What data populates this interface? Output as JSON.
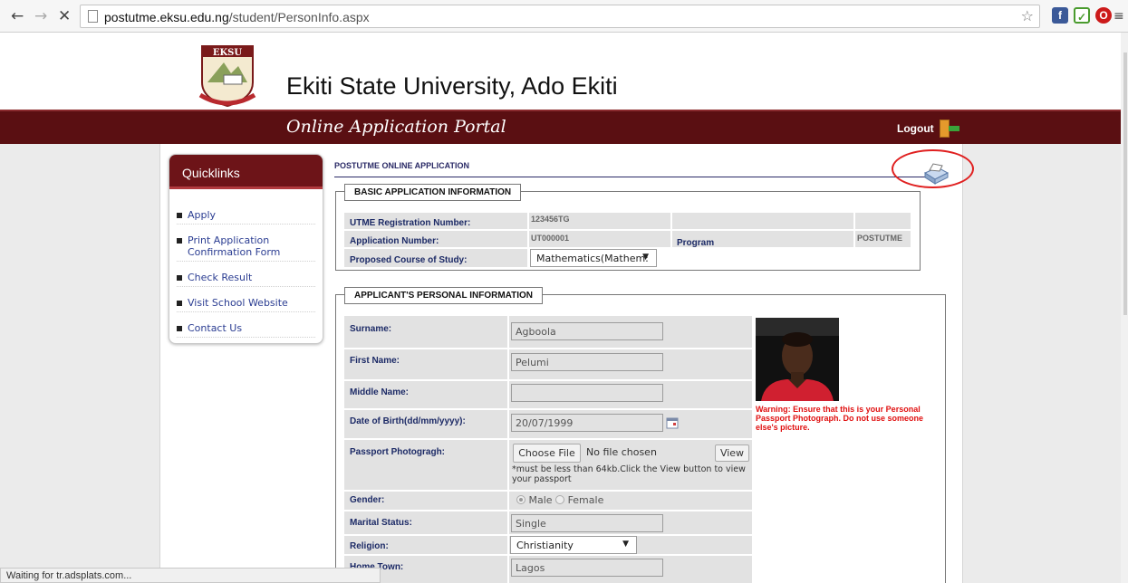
{
  "browser": {
    "url_host": "postutme.eksu.edu.ng",
    "url_path": "/student/PersonInfo.aspx",
    "status_text": "Waiting for tr.adsplats.com...",
    "extensions": [
      "facebook-icon",
      "shield-check-icon",
      "opera-icon"
    ]
  },
  "header": {
    "university_name": "Ekiti State University, Ado Ekiti",
    "logo_text": "EKSU",
    "portal_title": "Online Application Portal",
    "logout_label": "Logout"
  },
  "sidebar": {
    "title": "Quicklinks",
    "items": [
      {
        "label": "Apply"
      },
      {
        "label": "Print Application Confirmation Form"
      },
      {
        "label": "Check Result"
      },
      {
        "label": "Visit School Website"
      },
      {
        "label": "Contact Us"
      }
    ]
  },
  "main": {
    "section_title": "POSTUTME ONLINE APPLICATION",
    "basic": {
      "legend": "BASIC APPLICATION INFORMATION",
      "utme_label": "UTME Registration Number:",
      "utme_value": "123456TG",
      "appno_label": "Application Number:",
      "appno_value": "UT000001",
      "program_label": "Program",
      "program_value": "POSTUTME",
      "course_label": "Proposed Course of Study:",
      "course_value": "Mathematics(Mathem:"
    },
    "personal": {
      "legend": "APPLICANT'S PERSONAL INFORMATION",
      "surname_label": "Surname:",
      "surname_value": "Agboola",
      "firstname_label": "First Name:",
      "firstname_value": "Pelumi",
      "middlename_label": "Middle Name:",
      "middlename_value": "",
      "dob_label": "Date of Birth(dd/mm/yyyy):",
      "dob_value": "20/07/1999",
      "passport_label": "Passport Photogragh:",
      "choose_file_label": "Choose File",
      "no_file_text": "No file chosen",
      "view_label": "View",
      "passport_note": "*must be less than 64kb.Click the View button to view your passport",
      "gender_label": "Gender:",
      "gender_male": "Male",
      "gender_female": "Female",
      "gender_selected": "Male",
      "marital_label": "Marital Status:",
      "marital_value": "Single",
      "religion_label": "Religion:",
      "religion_value": "Christianity",
      "hometown_label": "Home Town:",
      "hometown_value": "Lagos",
      "warning": "Warning: Ensure that this is your Personal Passport Photograph. Do not use someone else's picture."
    }
  }
}
